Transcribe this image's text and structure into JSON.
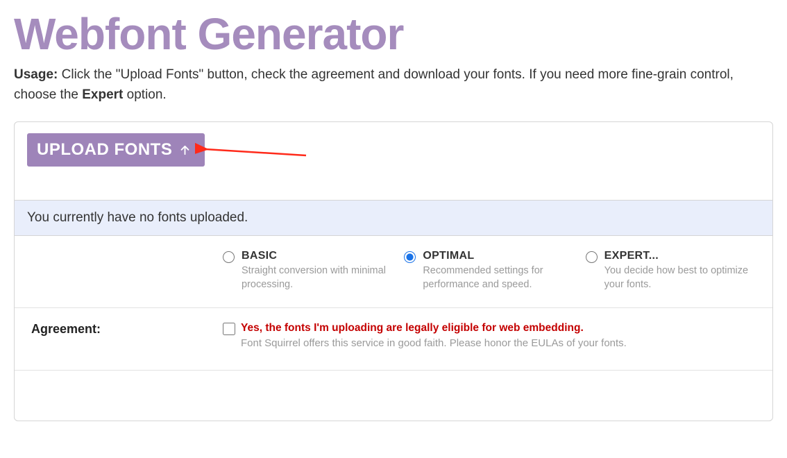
{
  "title": "Webfont Generator",
  "usage": {
    "label": "Usage:",
    "text_part1": " Click the \"Upload Fonts\" button, check the agreement and download your fonts. If you need more fine-grain control, choose the ",
    "expert_word": "Expert",
    "text_part2": " option."
  },
  "upload_button_label": "UPLOAD FONTS",
  "status_message": "You currently have no fonts uploaded.",
  "options": {
    "basic": {
      "label": "BASIC",
      "desc": "Straight conversion with minimal processing."
    },
    "optimal": {
      "label": "OPTIMAL",
      "desc": "Recommended settings for performance and speed."
    },
    "expert": {
      "label": "EXPERT...",
      "desc": "You decide how best to optimize your fonts."
    }
  },
  "agreement": {
    "heading": "Agreement:",
    "checkbox_text": "Yes, the fonts I'm uploading are legally eligible for web embedding.",
    "sub_text": "Font Squirrel offers this service in good faith. Please honor the EULAs of your fonts."
  }
}
